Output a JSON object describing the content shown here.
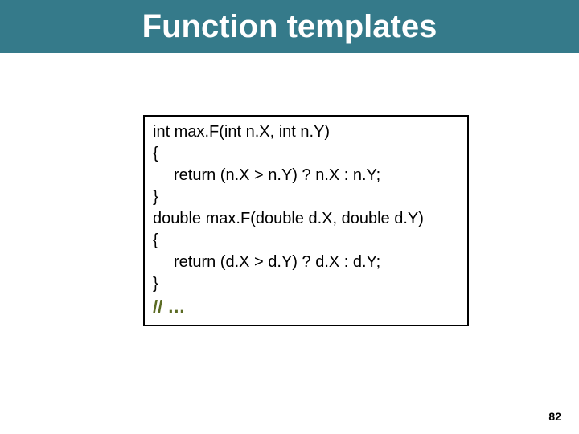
{
  "title": "Function templates",
  "code": {
    "line1": "int max.F(int n.X, int n.Y)",
    "line2": "{",
    "line3": "return (n.X > n.Y) ? n.X : n.Y;",
    "line4": "}",
    "line5": "double max.F(double d.X, double d.Y)",
    "line6": "{",
    "line7": "return (d.X > d.Y) ? d.X : d.Y;",
    "line8": "}",
    "comment": "// …"
  },
  "page_number": "82"
}
